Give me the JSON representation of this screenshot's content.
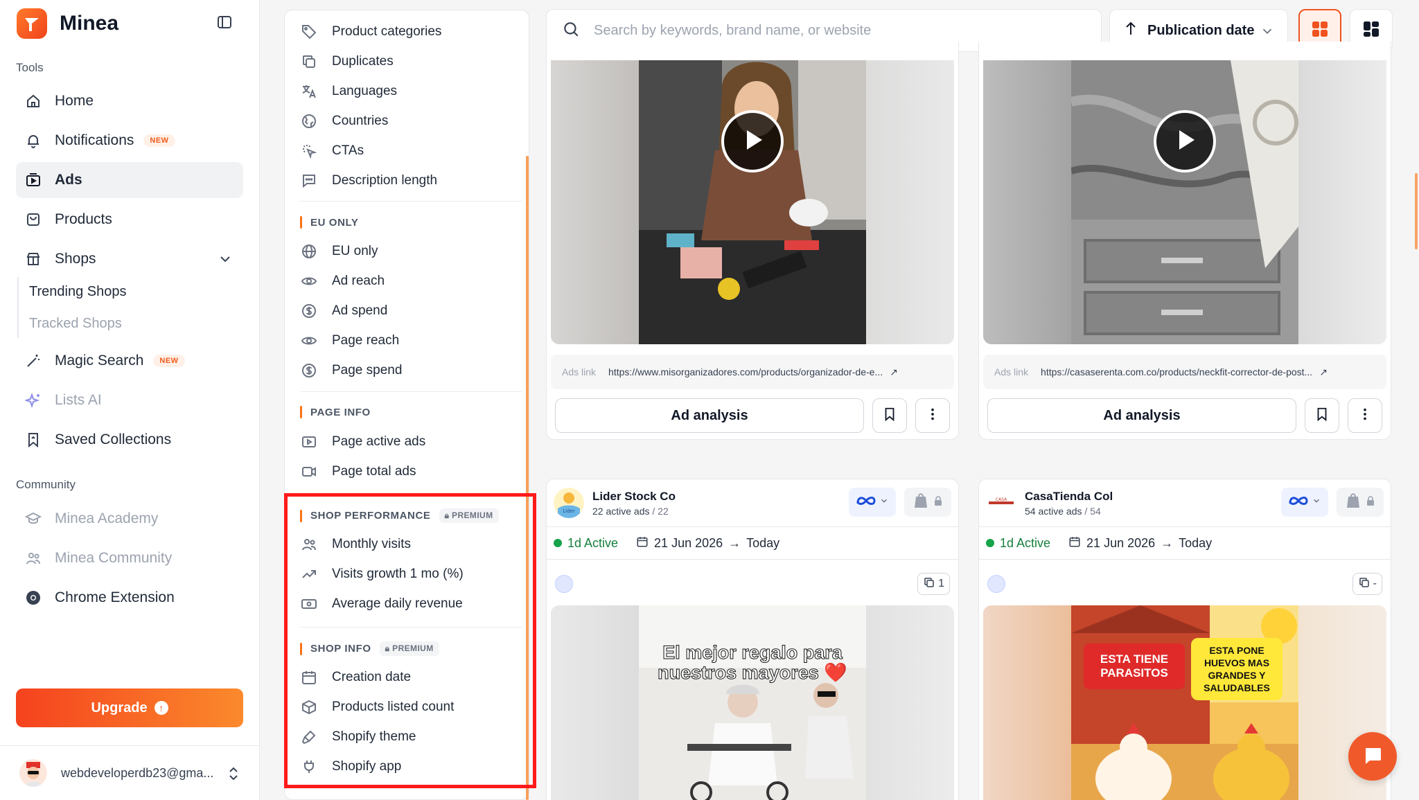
{
  "app": {
    "name": "Minea"
  },
  "sidebar": {
    "tools_label": "Tools",
    "items": [
      {
        "label": "Home",
        "icon": "home-icon"
      },
      {
        "label": "Notifications",
        "icon": "bell-icon",
        "badge": "NEW"
      },
      {
        "label": "Ads",
        "icon": "ads-icon",
        "active": true
      },
      {
        "label": "Products",
        "icon": "products-icon"
      },
      {
        "label": "Shops",
        "icon": "shop-icon"
      }
    ],
    "shops_sub": [
      "Trending Shops",
      "Tracked Shops"
    ],
    "magic_search": {
      "label": "Magic Search",
      "badge": "NEW"
    },
    "lists_ai": "Lists AI",
    "saved_collections": "Saved Collections",
    "community_label": "Community",
    "community_items": [
      "Minea Academy",
      "Minea Community",
      "Chrome Extension"
    ],
    "upgrade_label": "Upgrade",
    "user_email": "webdeveloperdb23@gma..."
  },
  "filters": {
    "group1": [
      "Product categories",
      "Duplicates",
      "Languages",
      "Countries",
      "CTAs",
      "Description length"
    ],
    "eu_header": "EU ONLY",
    "eu_items": [
      "EU only",
      "Ad reach",
      "Ad spend",
      "Page reach",
      "Page spend"
    ],
    "page_info_header": "PAGE INFO",
    "page_info_items": [
      "Page active ads",
      "Page total ads"
    ],
    "shop_perf_header": "SHOP PERFORMANCE",
    "shop_perf_items": [
      "Monthly visits",
      "Visits growth 1 mo (%)",
      "Average daily revenue"
    ],
    "shop_info_header": "SHOP INFO",
    "shop_info_items": [
      "Creation date",
      "Products listed count",
      "Shopify theme",
      "Shopify app"
    ],
    "premium_label": "PREMIUM"
  },
  "topbar": {
    "search_placeholder": "Search by keywords, brand name, or website",
    "sort_label": "Publication date"
  },
  "cards_top": [
    {
      "ads_link_label": "Ads link",
      "url": "https://www.misorganizadores.com/products/organizador-de-e...",
      "analysis_label": "Ad analysis"
    },
    {
      "ads_link_label": "Ads link",
      "url": "https://casaserenta.com.co/products/neckfit-corrector-de-post...",
      "analysis_label": "Ad analysis"
    }
  ],
  "cards_bottom": [
    {
      "shop_name": "Lider Stock Co",
      "active_ads": "22 active ads",
      "total": "/ 22",
      "status": "1d Active",
      "date_from": "21 Jun 2026",
      "date_to": "Today",
      "dup_count": "1",
      "caption": "El mejor regalo para nuestros mayores ❤️"
    },
    {
      "shop_name": "CasaTienda Col",
      "active_ads": "54 active ads",
      "total": "/ 54",
      "status": "1d Active",
      "date_from": "21 Jun 2026",
      "date_to": "Today",
      "dup_count": "-",
      "banner_left": "ESTA TIENE PARASITOS",
      "banner_right": "ESTA PONE HUEVOS MAS GRANDES Y SALUDABLES"
    }
  ],
  "colors": {
    "accent": "#f0531f",
    "highlight": "#ff1a1a",
    "active": "#16a34a"
  }
}
